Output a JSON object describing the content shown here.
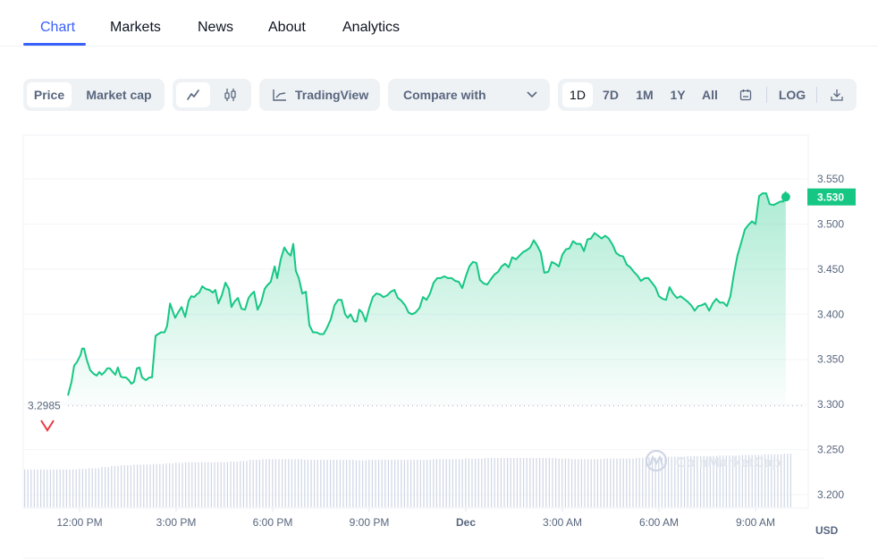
{
  "tabs": [
    {
      "label": "Chart",
      "active": true
    },
    {
      "label": "Markets",
      "active": false
    },
    {
      "label": "News",
      "active": false
    },
    {
      "label": "About",
      "active": false
    },
    {
      "label": "Analytics",
      "active": false
    }
  ],
  "toolbar": {
    "metric_toggle": [
      {
        "label": "Price",
        "active": true
      },
      {
        "label": "Market cap",
        "active": false
      }
    ],
    "chart_type_toggle": [
      {
        "icon": "line-chart-icon",
        "active": true
      },
      {
        "icon": "candlestick-icon",
        "active": false
      }
    ],
    "tradingview_label": "TradingView",
    "compare_placeholder": "Compare with",
    "ranges": [
      {
        "label": "1D",
        "active": true
      },
      {
        "label": "7D",
        "active": false
      },
      {
        "label": "1M",
        "active": false
      },
      {
        "label": "1Y",
        "active": false
      },
      {
        "label": "All",
        "active": false
      }
    ],
    "log_label": "LOG"
  },
  "colors": {
    "accent": "#3861fb",
    "up": "#16c784",
    "down": "#ea3943",
    "axis_text": "#58667e",
    "volume": "#cfd6e4"
  },
  "chart_data": {
    "type": "area",
    "title": "",
    "xlabel": "",
    "ylabel": "USD",
    "currency_label": "USD",
    "watermark": "CoinMarketCap",
    "open_price_label": "3.2985",
    "open_price": 3.2985,
    "current_price_label": "3.530",
    "current_price": 3.53,
    "ylim": [
      3.18,
      3.6
    ],
    "yticks": [
      3.2,
      3.25,
      3.3,
      3.35,
      3.4,
      3.45,
      3.5,
      3.55
    ],
    "ytick_labels": [
      "3.200",
      "3.250",
      "3.300",
      "3.350",
      "3.400",
      "3.450",
      "3.500",
      "3.550"
    ],
    "xlim_hours": [
      -0.55,
      22.25
    ],
    "xticks": [
      {
        "h": 0,
        "label": "12:00 PM",
        "bold": false
      },
      {
        "h": 3,
        "label": "3:00 PM",
        "bold": false
      },
      {
        "h": 6,
        "label": "6:00 PM",
        "bold": false
      },
      {
        "h": 9,
        "label": "9:00 PM",
        "bold": false
      },
      {
        "h": 12,
        "label": "Dec",
        "bold": true
      },
      {
        "h": 15,
        "label": "3:00 AM",
        "bold": false
      },
      {
        "h": 18,
        "label": "6:00 AM",
        "bold": false
      },
      {
        "h": 21,
        "label": "9:00 AM",
        "bold": false
      }
    ],
    "x_hours": [
      -0.36,
      -0.25,
      -0.17,
      -0.08,
      0.03,
      0.08,
      0.14,
      0.22,
      0.33,
      0.44,
      0.53,
      0.61,
      0.69,
      0.78,
      0.86,
      0.94,
      1.03,
      1.11,
      1.19,
      1.28,
      1.36,
      1.44,
      1.53,
      1.61,
      1.69,
      1.78,
      1.86,
      1.94,
      2.06,
      2.17,
      2.25,
      2.36,
      2.44,
      2.53,
      2.64,
      2.72,
      2.81,
      2.89,
      2.97,
      3.06,
      3.17,
      3.28,
      3.39,
      3.47,
      3.56,
      3.64,
      3.72,
      3.81,
      3.92,
      4.03,
      4.14,
      4.22,
      4.31,
      4.42,
      4.53,
      4.64,
      4.72,
      4.81,
      4.92,
      5.03,
      5.14,
      5.25,
      5.33,
      5.42,
      5.53,
      5.64,
      5.75,
      5.83,
      5.94,
      6.06,
      6.14,
      6.25,
      6.36,
      6.47,
      6.56,
      6.64,
      6.72,
      6.81,
      6.92,
      7.03,
      7.14,
      7.25,
      7.36,
      7.47,
      7.58,
      7.69,
      7.81,
      7.92,
      8.03,
      8.14,
      8.25,
      8.33,
      8.42,
      8.53,
      8.61,
      8.69,
      8.78,
      8.89,
      9.0,
      9.11,
      9.22,
      9.33,
      9.44,
      9.56,
      9.67,
      9.78,
      9.89,
      10.0,
      10.11,
      10.22,
      10.33,
      10.44,
      10.56,
      10.67,
      10.78,
      10.89,
      11.0,
      11.11,
      11.22,
      11.33,
      11.44,
      11.56,
      11.67,
      11.78,
      11.89,
      12.0,
      12.11,
      12.22,
      12.33,
      12.44,
      12.56,
      12.67,
      12.78,
      12.89,
      13.0,
      13.11,
      13.22,
      13.33,
      13.44,
      13.56,
      13.67,
      13.78,
      13.89,
      14.0,
      14.11,
      14.22,
      14.33,
      14.44,
      14.56,
      14.67,
      14.78,
      14.89,
      15.0,
      15.11,
      15.22,
      15.33,
      15.44,
      15.56,
      15.67,
      15.78,
      15.89,
      16.0,
      16.11,
      16.22,
      16.33,
      16.44,
      16.56,
      16.67,
      16.78,
      16.89,
      17.0,
      17.11,
      17.22,
      17.33,
      17.44,
      17.56,
      17.67,
      17.78,
      17.89,
      18.0,
      18.11,
      18.22,
      18.33,
      18.44,
      18.56,
      18.67,
      18.78,
      18.89,
      19.0,
      19.11,
      19.22,
      19.33,
      19.44,
      19.56,
      19.67,
      19.78,
      19.89,
      20.0,
      20.11,
      20.22,
      20.33,
      20.44,
      20.56,
      20.67,
      20.78,
      20.89,
      21.0,
      21.11,
      21.22,
      21.33,
      21.44,
      21.56,
      21.67,
      21.78,
      21.86,
      21.94
    ],
    "series": [
      {
        "name": "Price",
        "values": [
          3.31,
          3.325,
          3.343,
          3.347,
          3.355,
          3.362,
          3.362,
          3.35,
          3.338,
          3.334,
          3.332,
          3.336,
          3.333,
          3.336,
          3.34,
          3.34,
          3.336,
          3.333,
          3.341,
          3.331,
          3.33,
          3.33,
          3.327,
          3.323,
          3.325,
          3.34,
          3.341,
          3.33,
          3.327,
          3.33,
          3.33,
          3.376,
          3.378,
          3.38,
          3.38,
          3.387,
          3.412,
          3.404,
          3.396,
          3.402,
          3.408,
          3.397,
          3.415,
          3.42,
          3.419,
          3.422,
          3.424,
          3.431,
          3.428,
          3.427,
          3.424,
          3.427,
          3.412,
          3.421,
          3.435,
          3.428,
          3.408,
          3.414,
          3.418,
          3.406,
          3.405,
          3.418,
          3.422,
          3.425,
          3.405,
          3.413,
          3.428,
          3.432,
          3.436,
          3.453,
          3.44,
          3.461,
          3.474,
          3.468,
          3.465,
          3.478,
          3.448,
          3.44,
          3.423,
          3.425,
          3.388,
          3.38,
          3.38,
          3.378,
          3.378,
          3.385,
          3.395,
          3.41,
          3.416,
          3.416,
          3.4,
          3.396,
          3.4,
          3.392,
          3.392,
          3.405,
          3.402,
          3.392,
          3.407,
          3.419,
          3.423,
          3.422,
          3.419,
          3.421,
          3.425,
          3.427,
          3.418,
          3.415,
          3.41,
          3.402,
          3.4,
          3.402,
          3.407,
          3.419,
          3.416,
          3.423,
          3.435,
          3.44,
          3.44,
          3.442,
          3.44,
          3.44,
          3.437,
          3.436,
          3.429,
          3.442,
          3.453,
          3.458,
          3.457,
          3.438,
          3.434,
          3.433,
          3.439,
          3.444,
          3.447,
          3.453,
          3.456,
          3.452,
          3.463,
          3.461,
          3.465,
          3.469,
          3.471,
          3.474,
          3.482,
          3.476,
          3.468,
          3.446,
          3.447,
          3.458,
          3.456,
          3.453,
          3.466,
          3.472,
          3.473,
          3.481,
          3.478,
          3.478,
          3.47,
          3.483,
          3.484,
          3.49,
          3.487,
          3.484,
          3.487,
          3.484,
          3.477,
          3.468,
          3.465,
          3.464,
          3.455,
          3.452,
          3.447,
          3.443,
          3.437,
          3.44,
          3.44,
          3.435,
          3.43,
          3.42,
          3.417,
          3.416,
          3.43,
          3.423,
          3.418,
          3.42,
          3.417,
          3.414,
          3.41,
          3.404,
          3.409,
          3.41,
          3.412,
          3.404,
          3.412,
          3.417,
          3.413,
          3.413,
          3.409,
          3.42,
          3.445,
          3.465,
          3.48,
          3.494,
          3.499,
          3.503,
          3.5,
          3.531,
          3.534,
          3.534,
          3.522,
          3.521,
          3.523,
          3.525,
          3.525,
          3.536,
          3.541,
          3.545,
          3.552,
          3.548,
          3.549,
          3.544,
          3.542,
          3.536,
          3.541,
          3.535,
          3.547,
          3.555,
          3.53
        ]
      }
    ],
    "volume_note": "relative volume bars, slowly increasing",
    "volume_levels": [
      0.62,
      0.62,
      0.62,
      0.62,
      0.62,
      0.63,
      0.64,
      0.66,
      0.68,
      0.69,
      0.7,
      0.7,
      0.71,
      0.72,
      0.73,
      0.74,
      0.74,
      0.74,
      0.74,
      0.75,
      0.76,
      0.78,
      0.79,
      0.79,
      0.79,
      0.79,
      0.78,
      0.78,
      0.78,
      0.78,
      0.78,
      0.77,
      0.78,
      0.78,
      0.78,
      0.78,
      0.78,
      0.78,
      0.79,
      0.79,
      0.79,
      0.8,
      0.8,
      0.81,
      0.81,
      0.81,
      0.81,
      0.81,
      0.81,
      0.81,
      0.8,
      0.79,
      0.79,
      0.79,
      0.8,
      0.8,
      0.8,
      0.81,
      0.82,
      0.82,
      0.83,
      0.83,
      0.84,
      0.84,
      0.84,
      0.85,
      0.85,
      0.86,
      0.86,
      0.87,
      0.87,
      0.88
    ]
  }
}
